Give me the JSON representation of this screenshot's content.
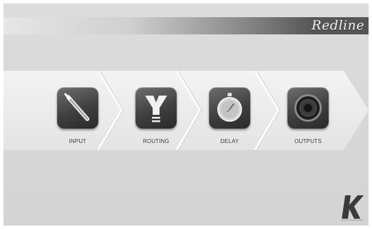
{
  "app": {
    "brand": "Redline",
    "logo_icon": "k-array-logo"
  },
  "steps": [
    {
      "label": "INPUT",
      "icon": "jack-cable-icon"
    },
    {
      "label": "ROUTING",
      "icon": "routing-arrows-icon"
    },
    {
      "label": "DELAY",
      "icon": "stopwatch-icon"
    },
    {
      "label": "OUTPUTS",
      "icon": "speaker-icon"
    }
  ],
  "colors": {
    "background": "#d6d6d6",
    "band": "#ececec",
    "tile": "#4a4a4a"
  }
}
